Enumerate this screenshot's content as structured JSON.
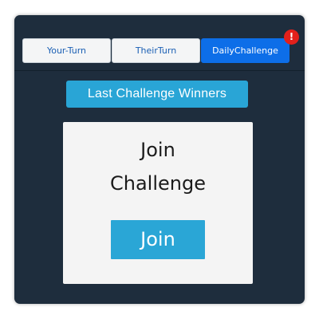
{
  "tabs": [
    {
      "label": "Your-Turn",
      "active": false
    },
    {
      "label": "TheirTurn",
      "active": false
    },
    {
      "label": "DailyChallenge",
      "active": true
    }
  ],
  "alert_badge": "!",
  "winners_button_label": "Last Challenge Winners",
  "card": {
    "title_line1": "Join",
    "title_line2": "Challenge",
    "join_button_label": "Join"
  },
  "colors": {
    "panel_bg": "#1e2d3d",
    "active_tab": "#0d6ee8",
    "tab_text": "#1a5fb4",
    "accent_button": "#29a5d6",
    "badge": "#e3201b"
  }
}
